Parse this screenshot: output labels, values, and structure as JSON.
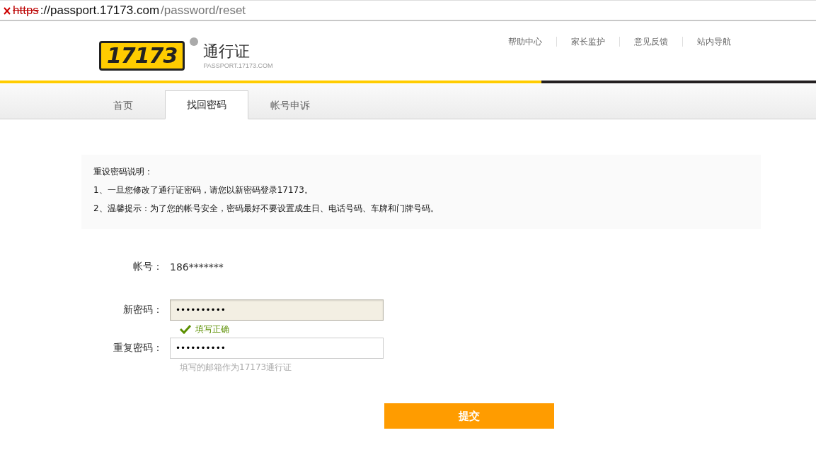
{
  "address_bar": {
    "scheme": "https",
    "insecure": true,
    "host": "://passport.17173.com",
    "path": "/password/reset"
  },
  "header": {
    "logo_mark": "17173",
    "logo_title": "通行证",
    "logo_subtitle": "PASSPORT.17173.COM",
    "links": [
      "帮助中心",
      "家长监护",
      "意见反馈",
      "站内导航"
    ]
  },
  "tabs": [
    {
      "label": "首页",
      "selected": false
    },
    {
      "label": "找回密码",
      "selected": true
    },
    {
      "label": "帐号申诉",
      "selected": false
    }
  ],
  "notice": {
    "title": "重设密码说明：",
    "lines": [
      "1、一旦您修改了通行证密码，请您以新密码登录17173。",
      "2、温馨提示：为了您的帐号安全，密码最好不要设置成生日、电话号码、车牌和门牌号码。"
    ]
  },
  "account": {
    "label": "帐号：",
    "value": "186*******"
  },
  "fields": [
    {
      "label": "新密码：",
      "value": "••••••••••",
      "focused": true,
      "kind": "valid",
      "message": "填写正确"
    },
    {
      "label": "重复密码：",
      "value": "••••••••••",
      "focused": false,
      "kind": "hint",
      "message": "填写的邮箱作为17173通行证"
    }
  ],
  "submit": "提交"
}
